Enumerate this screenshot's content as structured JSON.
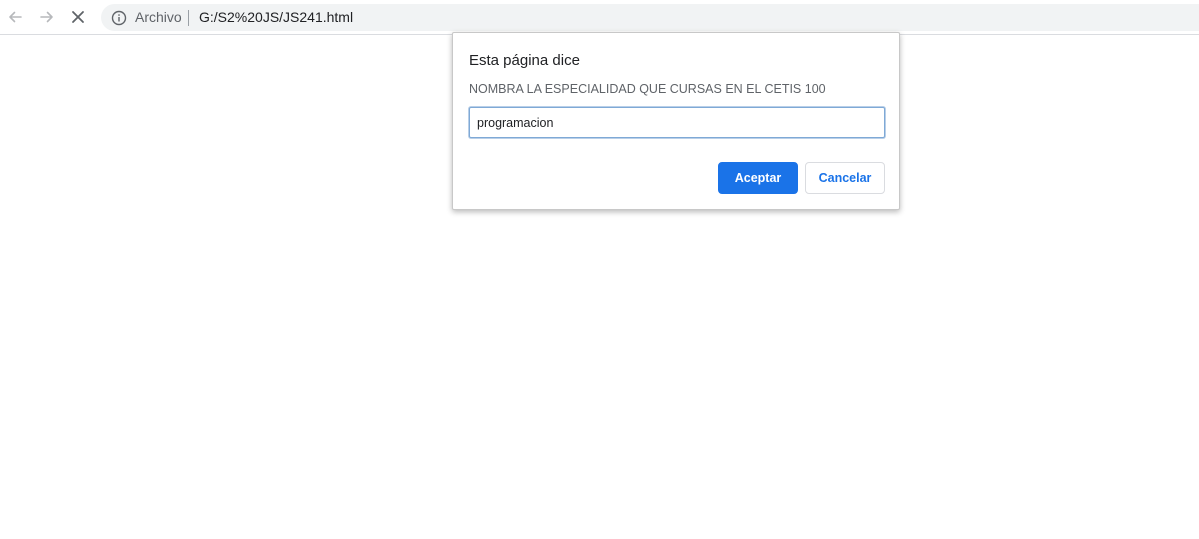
{
  "toolbar": {
    "back_icon": "arrow-left-icon",
    "forward_icon": "arrow-right-icon",
    "stop_icon": "close-icon",
    "omnibox": {
      "security_icon": "info-icon",
      "scheme_label": "Archivo",
      "url": "G:/S2%20JS/JS241.html"
    }
  },
  "dialog": {
    "title": "Esta página dice",
    "message": "NOMBRA LA ESPECIALIDAD QUE CURSAS EN EL CETIS 100",
    "input_value": "programacion",
    "accept_label": "Aceptar",
    "cancel_label": "Cancelar"
  },
  "colors": {
    "accent": "#1a73e8",
    "omnibox_bg": "#f1f3f4",
    "icon_gray": "#5f6368"
  }
}
